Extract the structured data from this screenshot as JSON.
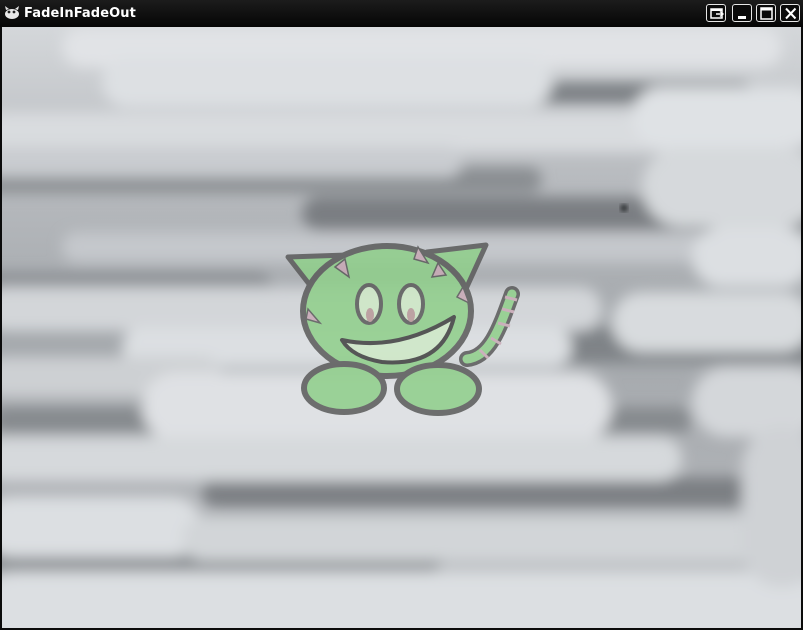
{
  "window": {
    "title": "FadeInFadeOut",
    "buttons": [
      "restore",
      "minimize",
      "maximize",
      "close"
    ]
  },
  "colors": {
    "titlebar": "#0b0b0b",
    "title_text": "#ffffff",
    "cloud_light": "#dde0e3",
    "cloud_dark": "#7b7f83",
    "cat_body": "#8fcf8a",
    "cat_outline": "#5a5a5a",
    "cat_stripes": "#c9a9b6"
  },
  "icons": [
    "app-icon",
    "restore-icon",
    "minimize-icon",
    "maximize-icon",
    "close-icon"
  ],
  "scene": {
    "background": "cloud-texture",
    "sprite": "green-cat",
    "sprite_opacity": 0.85
  }
}
